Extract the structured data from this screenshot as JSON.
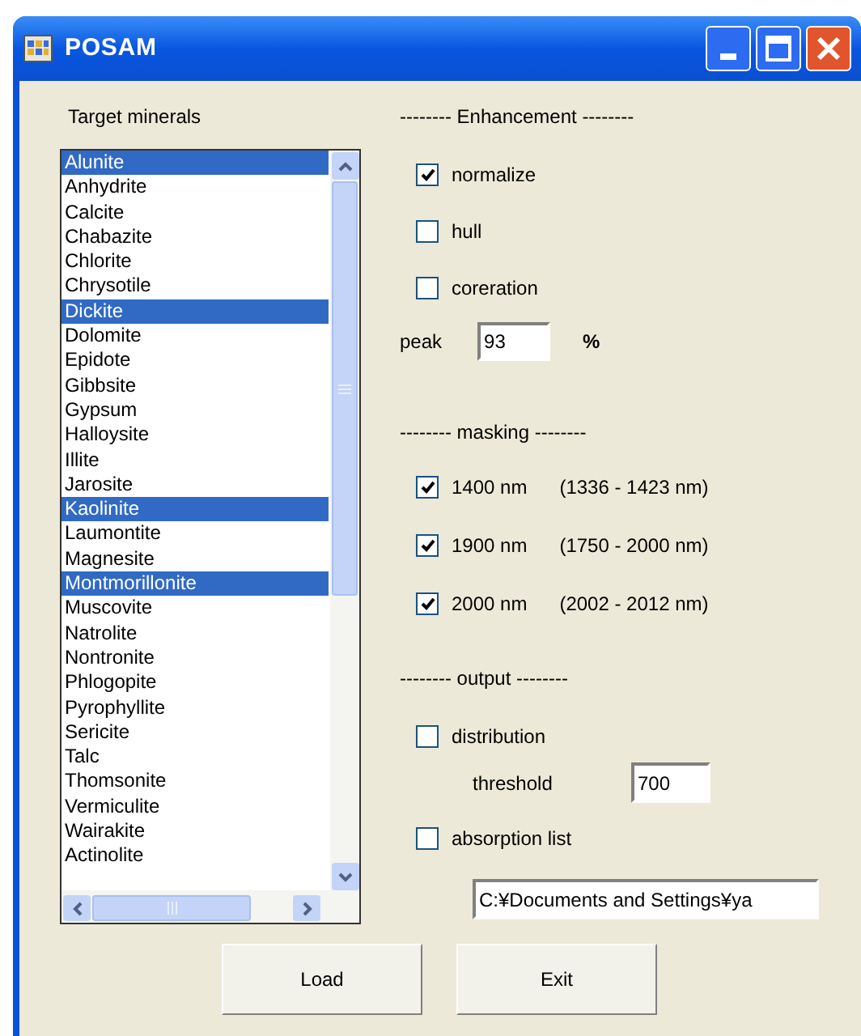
{
  "window": {
    "title": "POSAM"
  },
  "minerals": {
    "label": "Target minerals",
    "items": [
      {
        "name": "Alunite",
        "selected": true
      },
      {
        "name": "Anhydrite",
        "selected": false
      },
      {
        "name": "Calcite",
        "selected": false
      },
      {
        "name": "Chabazite",
        "selected": false
      },
      {
        "name": "Chlorite",
        "selected": false
      },
      {
        "name": "Chrysotile",
        "selected": false
      },
      {
        "name": "Dickite",
        "selected": true
      },
      {
        "name": "Dolomite",
        "selected": false
      },
      {
        "name": "Epidote",
        "selected": false
      },
      {
        "name": "Gibbsite",
        "selected": false
      },
      {
        "name": "Gypsum",
        "selected": false
      },
      {
        "name": "Halloysite",
        "selected": false
      },
      {
        "name": "Illite",
        "selected": false
      },
      {
        "name": "Jarosite",
        "selected": false
      },
      {
        "name": "Kaolinite",
        "selected": true
      },
      {
        "name": "Laumontite",
        "selected": false
      },
      {
        "name": "Magnesite",
        "selected": false
      },
      {
        "name": "Montmorillonite",
        "selected": true
      },
      {
        "name": "Muscovite",
        "selected": false
      },
      {
        "name": "Natrolite",
        "selected": false
      },
      {
        "name": "Nontronite",
        "selected": false
      },
      {
        "name": "Phlogopite",
        "selected": false
      },
      {
        "name": "Pyrophyllite",
        "selected": false
      },
      {
        "name": "Sericite",
        "selected": false
      },
      {
        "name": "Talc",
        "selected": false
      },
      {
        "name": "Thomsonite",
        "selected": false
      },
      {
        "name": "Vermiculite",
        "selected": false
      },
      {
        "name": "Wairakite",
        "selected": false
      },
      {
        "name": "Actinolite",
        "selected": false
      }
    ]
  },
  "enhancement": {
    "heading": "-------- Enhancement --------",
    "options": [
      {
        "label": "normalize",
        "checked": true
      },
      {
        "label": "hull",
        "checked": false
      },
      {
        "label": "coreration",
        "checked": false
      }
    ],
    "peak": {
      "label": "peak",
      "value": "93",
      "unit": "%"
    }
  },
  "masking": {
    "heading": "-------- masking --------",
    "bands": [
      {
        "label": "1400 nm",
        "range": "(1336 - 1423 nm)",
        "checked": true
      },
      {
        "label": "1900 nm",
        "range": "(1750 - 2000 nm)",
        "checked": true
      },
      {
        "label": "2000 nm",
        "range": "(2002 - 2012 nm)",
        "checked": true
      }
    ]
  },
  "output": {
    "heading": "-------- output --------",
    "distribution": {
      "label": "distribution",
      "checked": false
    },
    "threshold": {
      "label": "threshold",
      "value": "700"
    },
    "absorption_list": {
      "label": "absorption list",
      "checked": false
    },
    "path": {
      "value": "C:¥Documents and Settings¥ya"
    }
  },
  "buttons": [
    "Load",
    "Exit"
  ]
}
